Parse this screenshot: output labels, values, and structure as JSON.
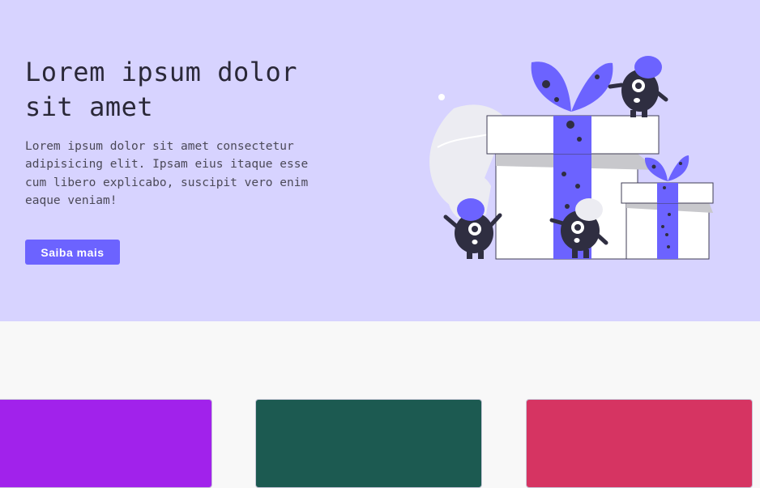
{
  "hero": {
    "title": "Lorem ipsum dolor sit amet",
    "description": "Lorem ipsum dolor sit amet consectetur adipisicing elit. Ipsam eius itaque esse cum libero explicabo, suscipit vero enim eaque veniam!",
    "button_label": "Saiba mais",
    "illustration": "gift-boxes-with-monsters-illustration"
  },
  "colors": {
    "hero_bg": "#d7d3ff",
    "accent": "#6c63ff",
    "card_purple": "#a122eb",
    "card_green": "#1c5a51",
    "card_pink": "#d63462"
  }
}
